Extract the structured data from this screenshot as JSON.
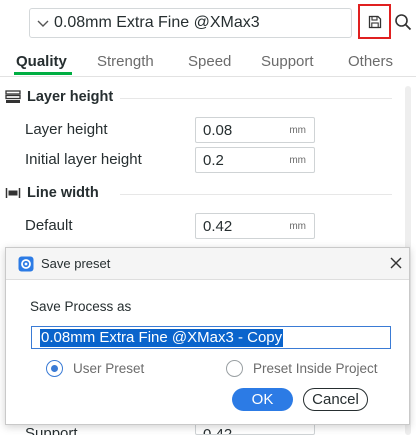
{
  "preset": {
    "selected": "0.08mm Extra Fine @XMax3"
  },
  "tabs": [
    "Quality",
    "Strength",
    "Speed",
    "Support",
    "Others"
  ],
  "sections": {
    "layer_height": {
      "title": "Layer height",
      "options": [
        {
          "label": "Layer height",
          "value": "0.08",
          "unit": "mm"
        },
        {
          "label": "Initial layer height",
          "value": "0.2",
          "unit": "mm"
        }
      ]
    },
    "line_width": {
      "title": "Line width",
      "options": [
        {
          "label": "Default",
          "value": "0.42",
          "unit": "mm"
        }
      ]
    },
    "partial": {
      "label": "Support",
      "value": "0.42"
    }
  },
  "dialog": {
    "title": "Save preset",
    "label": "Save Process as",
    "name_value": "0.08mm Extra Fine @XMax3 - Copy",
    "radio_user": "User Preset",
    "radio_project": "Preset Inside Project",
    "ok": "OK",
    "cancel": "Cancel"
  },
  "colors": {
    "accent_green": "#00ae42",
    "primary_blue": "#2c7be5",
    "highlight_red": "#e02020"
  }
}
